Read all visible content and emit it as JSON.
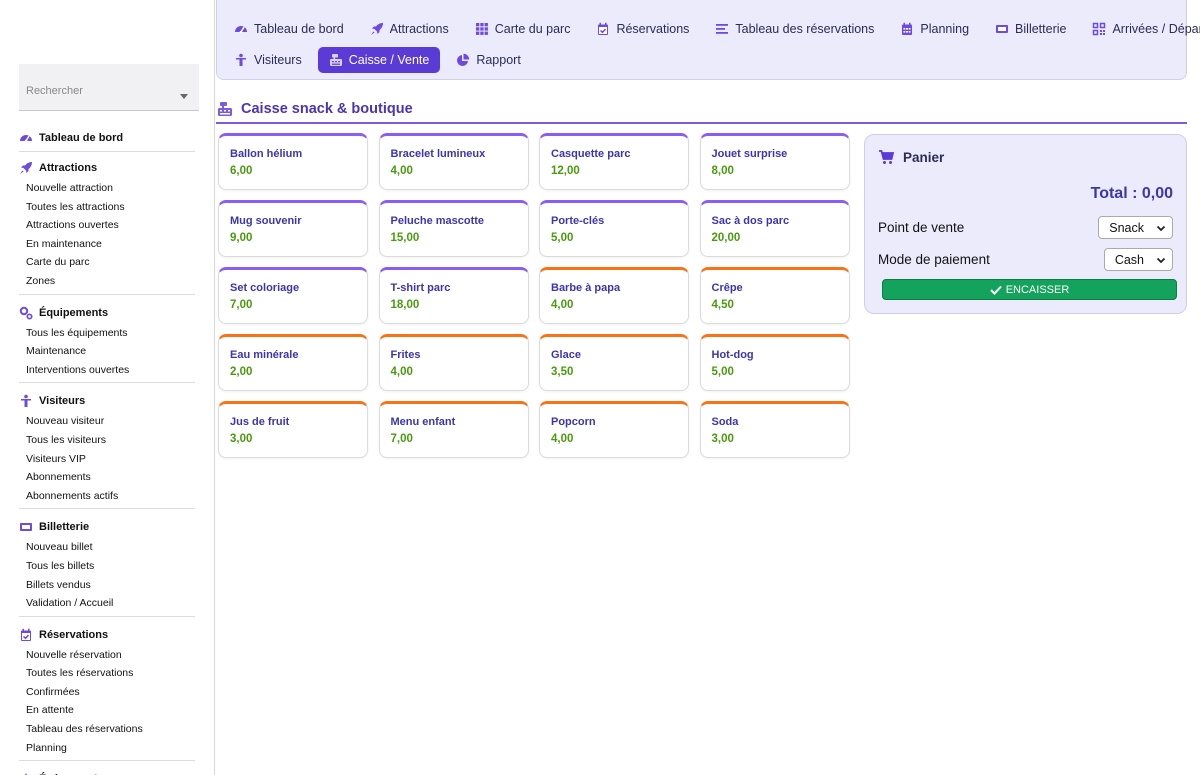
{
  "colors": {
    "accent": "#5a3bd6",
    "price": "#4a9a0e",
    "merch_border": "#8b5cf6",
    "food_border": "#f97316",
    "cashout": "#14a35c"
  },
  "sidebar": {
    "search_placeholder": "Rechercher",
    "sections": [
      {
        "title": "Tableau de bord",
        "icon": "gauge-icon",
        "items": []
      },
      {
        "title": "Attractions",
        "icon": "rocket-icon",
        "items": [
          "Nouvelle attraction",
          "Toutes les attractions",
          "Attractions ouvertes",
          "En maintenance",
          "Carte du parc",
          "Zones"
        ]
      },
      {
        "title": "Équipements",
        "icon": "gears-icon",
        "items": [
          "Tous les équipements",
          "Maintenance",
          "Interventions ouvertes"
        ]
      },
      {
        "title": "Visiteurs",
        "icon": "person-icon",
        "items": [
          "Nouveau visiteur",
          "Tous les visiteurs",
          "Visiteurs VIP",
          "Abonnements",
          "Abonnements actifs"
        ]
      },
      {
        "title": "Billetterie",
        "icon": "ticket-icon",
        "items": [
          "Nouveau billet",
          "Tous les billets",
          "Billets vendus",
          "Validation / Accueil"
        ]
      },
      {
        "title": "Réservations",
        "icon": "calendar-check-icon",
        "items": [
          "Nouvelle réservation",
          "Toutes les réservations",
          "Confirmées",
          "En attente",
          "Tableau des réservations",
          "Planning"
        ]
      },
      {
        "title": "Événements",
        "icon": "star-icon",
        "items": []
      }
    ]
  },
  "topnav": {
    "row1": [
      {
        "label": "Tableau de bord",
        "icon": "gauge-icon"
      },
      {
        "label": "Attractions",
        "icon": "rocket-icon"
      },
      {
        "label": "Carte du parc",
        "icon": "grid-icon"
      },
      {
        "label": "Réservations",
        "icon": "calendar-check-icon"
      },
      {
        "label": "Tableau des réservations",
        "icon": "list-icon"
      },
      {
        "label": "Planning",
        "icon": "calendar-icon"
      },
      {
        "label": "Billetterie",
        "icon": "ticket-icon"
      },
      {
        "label": "Arrivées / Départs",
        "icon": "qrcode-icon"
      }
    ],
    "row2": [
      {
        "label": "Visiteurs",
        "icon": "person-icon"
      },
      {
        "label": "Caisse / Vente",
        "icon": "cash-register-icon",
        "active": true
      },
      {
        "label": "Rapport",
        "icon": "pie-chart-icon"
      }
    ]
  },
  "page": {
    "title": "Caisse snack & boutique"
  },
  "products": [
    {
      "name": "Ballon hélium",
      "price": "6,00",
      "kind": "merch"
    },
    {
      "name": "Bracelet lumineux",
      "price": "4,00",
      "kind": "merch"
    },
    {
      "name": "Casquette parc",
      "price": "12,00",
      "kind": "merch"
    },
    {
      "name": "Jouet surprise",
      "price": "8,00",
      "kind": "merch"
    },
    {
      "name": "Mug souvenir",
      "price": "9,00",
      "kind": "merch"
    },
    {
      "name": "Peluche mascotte",
      "price": "15,00",
      "kind": "merch"
    },
    {
      "name": "Porte-clés",
      "price": "5,00",
      "kind": "merch"
    },
    {
      "name": "Sac à dos parc",
      "price": "20,00",
      "kind": "merch"
    },
    {
      "name": "Set coloriage",
      "price": "7,00",
      "kind": "merch"
    },
    {
      "name": "T-shirt parc",
      "price": "18,00",
      "kind": "merch"
    },
    {
      "name": "Barbe à papa",
      "price": "4,00",
      "kind": "food"
    },
    {
      "name": "Crêpe",
      "price": "4,50",
      "kind": "food"
    },
    {
      "name": "Eau minérale",
      "price": "2,00",
      "kind": "food"
    },
    {
      "name": "Frites",
      "price": "4,00",
      "kind": "food"
    },
    {
      "name": "Glace",
      "price": "3,50",
      "kind": "food"
    },
    {
      "name": "Hot-dog",
      "price": "5,00",
      "kind": "food"
    },
    {
      "name": "Jus de fruit",
      "price": "3,00",
      "kind": "food"
    },
    {
      "name": "Menu enfant",
      "price": "7,00",
      "kind": "food"
    },
    {
      "name": "Popcorn",
      "price": "4,00",
      "kind": "food"
    },
    {
      "name": "Soda",
      "price": "3,00",
      "kind": "food"
    }
  ],
  "cart": {
    "title": "Panier",
    "total": "Total : 0,00",
    "point_of_sale_label": "Point de vente",
    "point_of_sale_value": "Snack",
    "payment_label": "Mode de paiement",
    "payment_value": "Cash",
    "cashout_label": "ENCAISSER"
  }
}
